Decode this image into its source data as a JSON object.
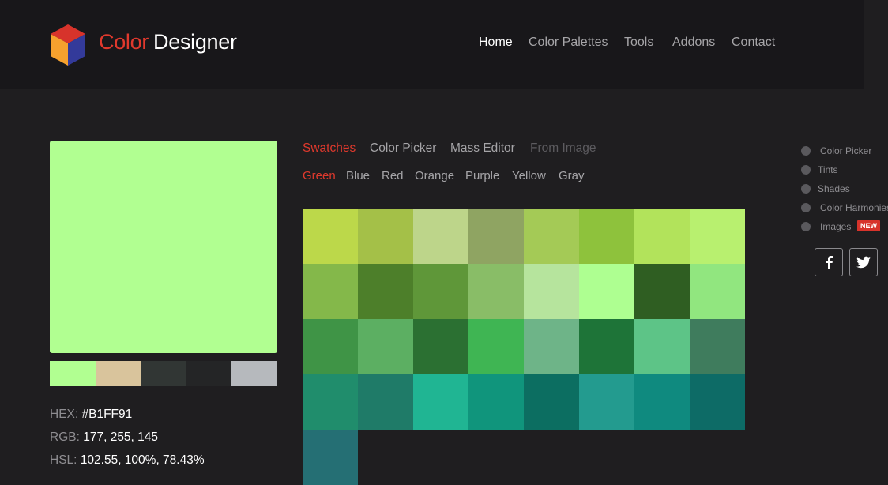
{
  "brand": {
    "part1": "Color",
    "part2": "Designer"
  },
  "nav": [
    {
      "label": "Home",
      "active": true
    },
    {
      "label": "Color Palettes"
    },
    {
      "label": "Tools"
    },
    {
      "label": "Addons"
    },
    {
      "label": "Contact"
    }
  ],
  "selected": {
    "color": "#B1FF91",
    "hex_label": "HEX:",
    "hex": "#B1FF91",
    "rgb_label": "RGB:",
    "rgb": "177, 255, 145",
    "hsl_label": "HSL:",
    "hsl": "102.55, 100%, 78.43%",
    "strip": [
      "#B1FF91",
      "#D9C49C",
      "#313634",
      "#242526",
      "#B6B9BD"
    ]
  },
  "tabs": [
    {
      "label": "Swatches",
      "active": true
    },
    {
      "label": "Color Picker"
    },
    {
      "label": "Mass Editor"
    },
    {
      "label": "From Image",
      "disabled": true
    }
  ],
  "categories": [
    {
      "label": "Green",
      "active": true
    },
    {
      "label": "Blue"
    },
    {
      "label": "Red"
    },
    {
      "label": "Orange"
    },
    {
      "label": "Purple"
    },
    {
      "label": "Yellow"
    },
    {
      "label": "Gray"
    }
  ],
  "swatches": [
    [
      "#BCD84A",
      "#A4C048",
      "#BDD58A",
      "#8FA462",
      "#A4CA56",
      "#8EC23C",
      "#B2E35B",
      "#B8F06F"
    ],
    [
      "#84B84A",
      "#4D7F2A",
      "#5F9739",
      "#89BD67",
      "#B6E49D",
      "#AEFF91",
      "#2F5E22",
      "#91E67F"
    ],
    [
      "#3F9446",
      "#5CAF62",
      "#2B7032",
      "#3FB553",
      "#6EB488",
      "#1E7438",
      "#5DC487",
      "#3F7C5D"
    ],
    [
      "#208D6C",
      "#1F7B68",
      "#20B593",
      "#10957C",
      "#0C6E61",
      "#239B8F",
      "#0F8A7F",
      "#0D6B66"
    ],
    [
      "#256F74"
    ]
  ],
  "sidebar": [
    {
      "label": "Color Picker"
    },
    {
      "label": "Tints"
    },
    {
      "label": "Shades"
    },
    {
      "label": "Color Harmonies"
    },
    {
      "label": "Images",
      "badge": "NEW"
    }
  ],
  "social": {
    "facebook": "facebook-icon",
    "twitter": "twitter-icon"
  },
  "colors": {
    "accent": "#E0392D",
    "background": "#1F1E20",
    "header": "#18171A"
  }
}
